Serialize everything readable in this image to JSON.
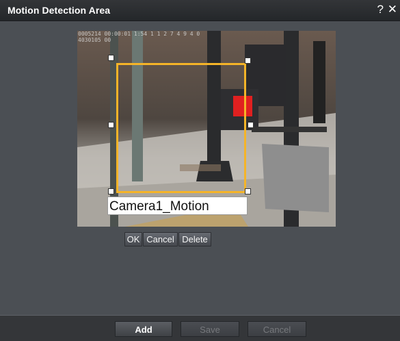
{
  "dialog": {
    "title": "Motion Detection Area",
    "help_label": "?",
    "close_label": "✕"
  },
  "video": {
    "overlay_lines": [
      "0005214 00:00:01 1:54 1 1 2 7 4 9 4 0",
      "4030105 00"
    ]
  },
  "zone": {
    "label": "Camera1_Motion",
    "color": "#f5b428"
  },
  "zone_actions": {
    "ok": "OK",
    "cancel": "Cancel",
    "delete": "Delete"
  },
  "footer": {
    "add": "Add",
    "save": "Save",
    "cancel": "Cancel"
  }
}
